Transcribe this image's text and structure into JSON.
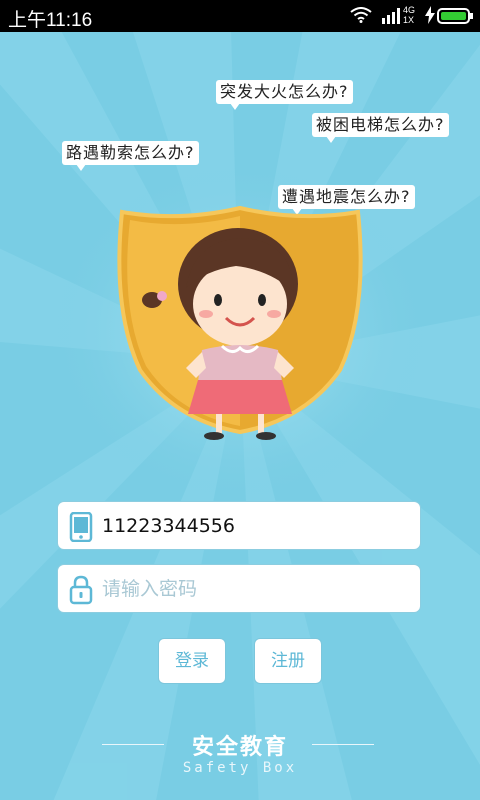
{
  "status_bar": {
    "time": "上午11:16",
    "network_top": "4G",
    "network_bottom": "1X",
    "battery_color": "#33cc33"
  },
  "bubbles": [
    "突发大火怎么办?",
    "被困电梯怎么办?",
    "路遇勒索怎么办?",
    "遭遇地震怎么办?"
  ],
  "form": {
    "phone_value": "11223344556",
    "password_placeholder": "请输入密码"
  },
  "buttons": {
    "login": "登录",
    "register": "注册"
  },
  "brand": {
    "title": "安全教育",
    "subtitle": "Safety Box"
  },
  "colors": {
    "background": "#79cde4",
    "accent": "#5db8d6",
    "shield": "#f2b33a"
  },
  "icons": {
    "phone": "phone-icon",
    "lock": "lock-icon"
  }
}
